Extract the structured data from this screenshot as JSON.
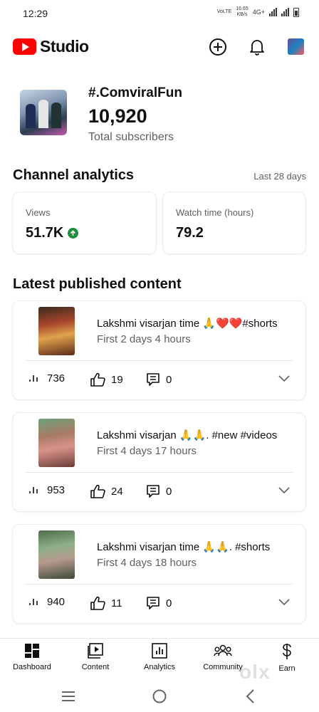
{
  "status_bar": {
    "time": "12:29",
    "network_left": "VoLTE",
    "speed_value": "16.65",
    "speed_unit": "KB/s",
    "network_4g": "4G+"
  },
  "app": {
    "logo_text": "Studio",
    "brand_color": "#ff0000"
  },
  "channel": {
    "name": "#.ComviralFun",
    "subscribers": "10,920",
    "subscribers_label": "Total subscribers"
  },
  "analytics": {
    "title": "Channel analytics",
    "period": "Last 28 days",
    "cards": [
      {
        "label": "Views",
        "value": "51.7K",
        "trend": "up"
      },
      {
        "label": "Watch time (hours)",
        "value": "79.2"
      }
    ]
  },
  "latest": {
    "title": "Latest published content",
    "items": [
      {
        "title": "Lakshmi visarjan time 🙏❤️❤️#shorts",
        "meta": "First 2 days 4 hours",
        "views": "736",
        "likes": "19",
        "comments": "0"
      },
      {
        "title": "Lakshmi visarjan 🙏🙏. #new #videos",
        "meta": "First 4 days 17 hours",
        "views": "953",
        "likes": "24",
        "comments": "0"
      },
      {
        "title": "Lakshmi visarjan time 🙏🙏. #shorts",
        "meta": "First 4 days 18 hours",
        "views": "940",
        "likes": "11",
        "comments": "0"
      }
    ]
  },
  "bottom_nav": [
    {
      "label": "Dashboard",
      "icon": "dashboard-icon",
      "active": true
    },
    {
      "label": "Content",
      "icon": "content-icon"
    },
    {
      "label": "Analytics",
      "icon": "analytics-icon"
    },
    {
      "label": "Community",
      "icon": "community-icon"
    },
    {
      "label": "Earn",
      "icon": "earn-icon"
    }
  ],
  "watermark": "olx"
}
